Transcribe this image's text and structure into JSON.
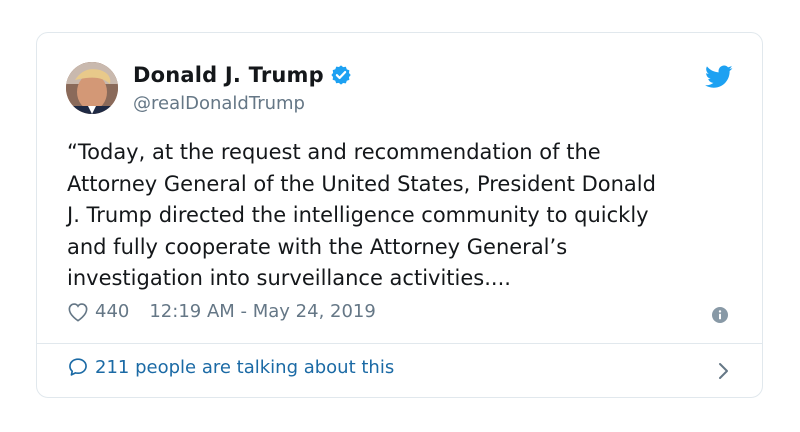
{
  "tweet": {
    "author": {
      "display_name": "Donald J. Trump",
      "handle": "@realDonaldTrump",
      "verified": true,
      "avatar_icon": "profile-photo"
    },
    "text_lines": [
      "“Today, at the request and recommendation of the",
      "Attorney General of the United States, President Donald",
      "J. Trump directed the intelligence community to quickly",
      "and fully cooperate with the Attorney General’s",
      "investigation into surveillance activities...."
    ],
    "likes": "440",
    "timestamp": "12:19 AM - May 24, 2019",
    "talking_about": "211 people are talking about this"
  },
  "icons": {
    "brand": "twitter-bird-icon",
    "verified": "verified-badge-icon",
    "like": "heart-icon",
    "info": "info-icon",
    "reply": "speech-bubble-icon",
    "more": "chevron-right-icon"
  },
  "colors": {
    "brand_blue": "#1da1f2",
    "link_blue": "#1b6aa5",
    "text": "#14171a",
    "muted": "#657786",
    "border": "#e1e8ed"
  }
}
